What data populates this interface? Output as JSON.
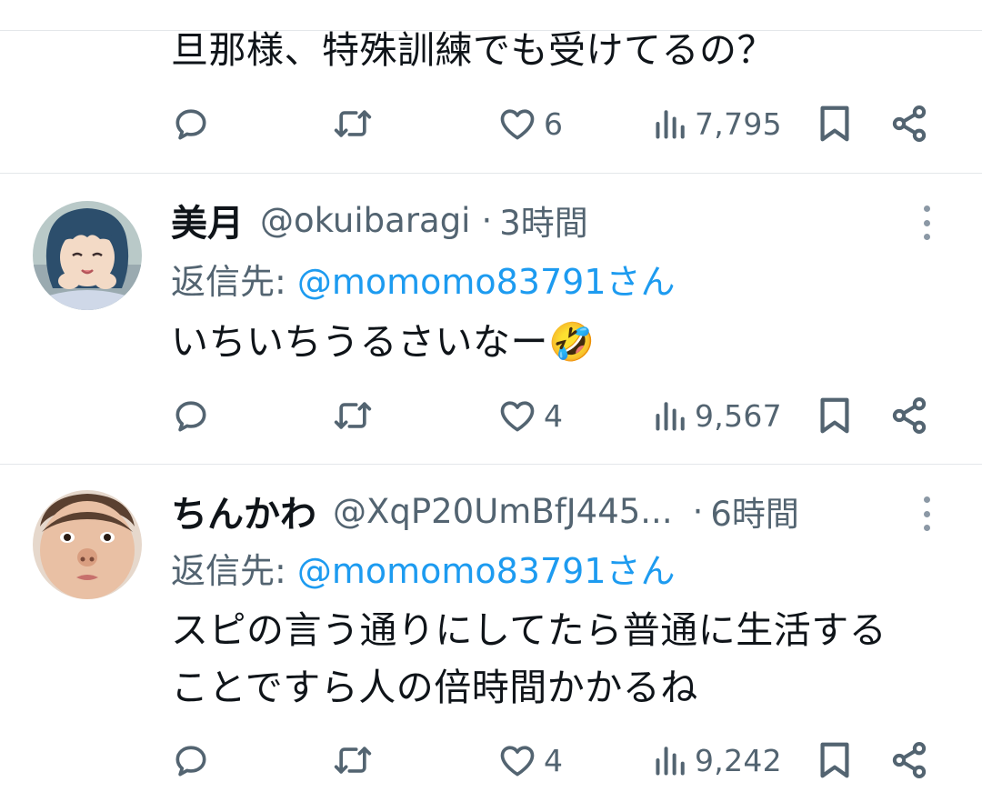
{
  "tweets": [
    {
      "text": [
        "旦那様、特殊訓練でも受けてるの？"
      ],
      "likes": "6",
      "views": "7,795"
    },
    {
      "display_name": "美月",
      "handle": "@okuibaragi",
      "separator": "·",
      "time": "3時間",
      "reply_prefix": "返信先:",
      "reply_to": "@momomo83791さん",
      "text": [
        "いちいちうるさいなー🤣"
      ],
      "likes": "4",
      "views": "9,567"
    },
    {
      "display_name": "ちんかわ",
      "handle": "@XqP20UmBfJ445...",
      "separator": "·",
      "time": "6時間",
      "reply_prefix": "返信先:",
      "reply_to": "@momomo83791さん",
      "text": [
        "スピの言う通りにしてたら普通に生活する",
        "ことですら人の倍時間かかるね"
      ],
      "likes": "4",
      "views": "9,242"
    }
  ],
  "icons": [
    "reply-icon",
    "retweet-icon",
    "like-icon",
    "views-icon",
    "bookmark-icon",
    "share-icon",
    "more-icon"
  ],
  "colors": {
    "text": "#0f1419",
    "secondary": "#536471",
    "link": "#1d9bf0",
    "divider": "#e4e7ea"
  }
}
